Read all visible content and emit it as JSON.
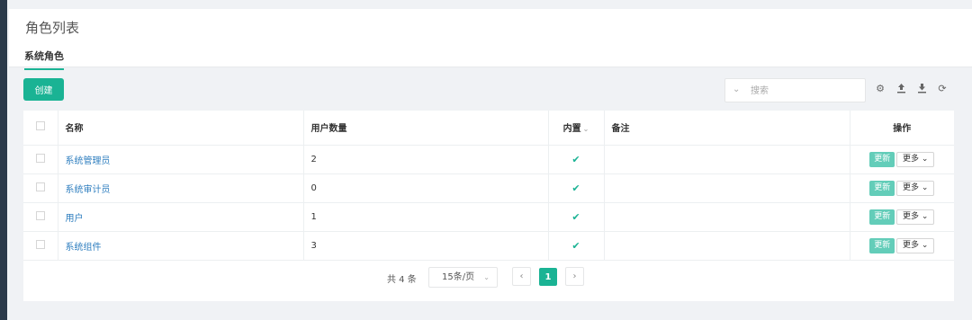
{
  "header": {
    "title": "角色列表",
    "tab": "系统角色"
  },
  "toolbar": {
    "create_label": "创建",
    "search_placeholder": "搜索",
    "icons": [
      "gear-icon",
      "upload-icon",
      "download-icon",
      "refresh-icon"
    ]
  },
  "table": {
    "headers": {
      "name": "名称",
      "user_count": "用户数量",
      "builtin": "内置",
      "note": "备注",
      "ops": "操作"
    },
    "rows": [
      {
        "name": "系统管理员",
        "user_count": "2",
        "builtin": true,
        "note": "",
        "update": "更新",
        "more": "更多"
      },
      {
        "name": "系统审计员",
        "user_count": "0",
        "builtin": true,
        "note": "",
        "update": "更新",
        "more": "更多"
      },
      {
        "name": "用户",
        "user_count": "1",
        "builtin": true,
        "note": "",
        "update": "更新",
        "more": "更多"
      },
      {
        "name": "系统组件",
        "user_count": "3",
        "builtin": true,
        "note": "",
        "update": "更新",
        "more": "更多"
      }
    ]
  },
  "pagination": {
    "total": "共 4 条",
    "page_size": "15条/页",
    "current_page": "1"
  },
  "colors": {
    "accent": "#1ab394",
    "link": "#2e7ebf"
  }
}
